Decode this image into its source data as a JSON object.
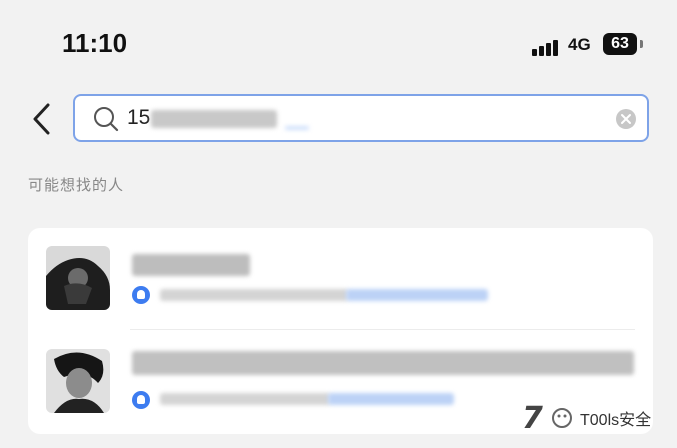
{
  "status_bar": {
    "time": "11:10",
    "network": "4G",
    "battery": "63"
  },
  "search": {
    "value": "15",
    "back_icon": "chevron-left-icon",
    "search_icon": "magnifier-icon",
    "clear_icon": "clear-circle-icon"
  },
  "section": {
    "label": "可能想找的人"
  },
  "results": [
    {
      "kind": "user",
      "badge_icon": "qq-badge-icon"
    },
    {
      "kind": "user",
      "badge_icon": "qq-badge-icon"
    }
  ],
  "watermark": {
    "text": "T00ls安全",
    "logo": "7"
  },
  "colors": {
    "accent": "#3d7cf0",
    "search_border": "#7ea3e8",
    "background": "#f2f2f2"
  }
}
